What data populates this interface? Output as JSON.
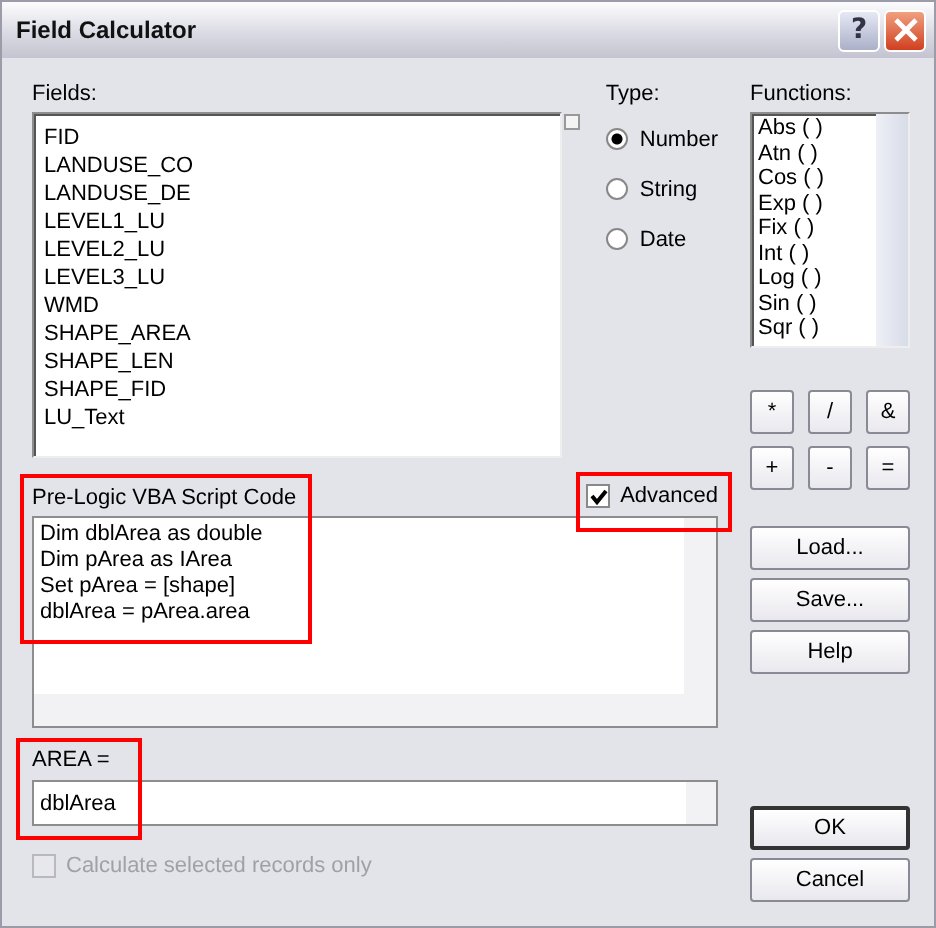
{
  "window": {
    "title": "Field Calculator",
    "help_glyph": "?"
  },
  "fields": {
    "label": "Fields:",
    "items": [
      "FID",
      "LANDUSE_CO",
      "LANDUSE_DE",
      "LEVEL1_LU",
      "LEVEL2_LU",
      "LEVEL3_LU",
      "WMD",
      "SHAPE_AREA",
      "SHAPE_LEN",
      "SHAPE_FID",
      "LU_Text"
    ]
  },
  "type": {
    "label": "Type:",
    "options": [
      {
        "label": "Number",
        "selected": true
      },
      {
        "label": "String",
        "selected": false
      },
      {
        "label": "Date",
        "selected": false
      }
    ]
  },
  "functions": {
    "label": "Functions:",
    "items": [
      "Abs ( )",
      "Atn ( )",
      "Cos ( )",
      "Exp ( )",
      "Fix ( )",
      "Int ( )",
      "Log ( )",
      "Sin ( )",
      "Sqr ( )"
    ]
  },
  "operators": [
    "*",
    "/",
    "&",
    "+",
    "-",
    "="
  ],
  "script": {
    "label": "Pre-Logic VBA Script Code",
    "highlighted": true,
    "lines": [
      "Dim dblArea as double",
      "Dim pArea as IArea",
      "Set pArea = [shape]",
      "dblArea = pArea.area"
    ]
  },
  "advanced": {
    "label": "Advanced",
    "checked": true,
    "highlighted": true
  },
  "expression": {
    "label": "AREA =",
    "value": "dblArea",
    "highlighted": true
  },
  "selected_only": {
    "label": "Calculate selected records only",
    "checked": false,
    "disabled": true
  },
  "buttons": [
    {
      "label": "Load..."
    },
    {
      "label": "Save..."
    },
    {
      "label": "Help"
    }
  ],
  "dialog_buttons": [
    {
      "label": "OK",
      "default": true
    },
    {
      "label": "Cancel",
      "default": false
    }
  ]
}
